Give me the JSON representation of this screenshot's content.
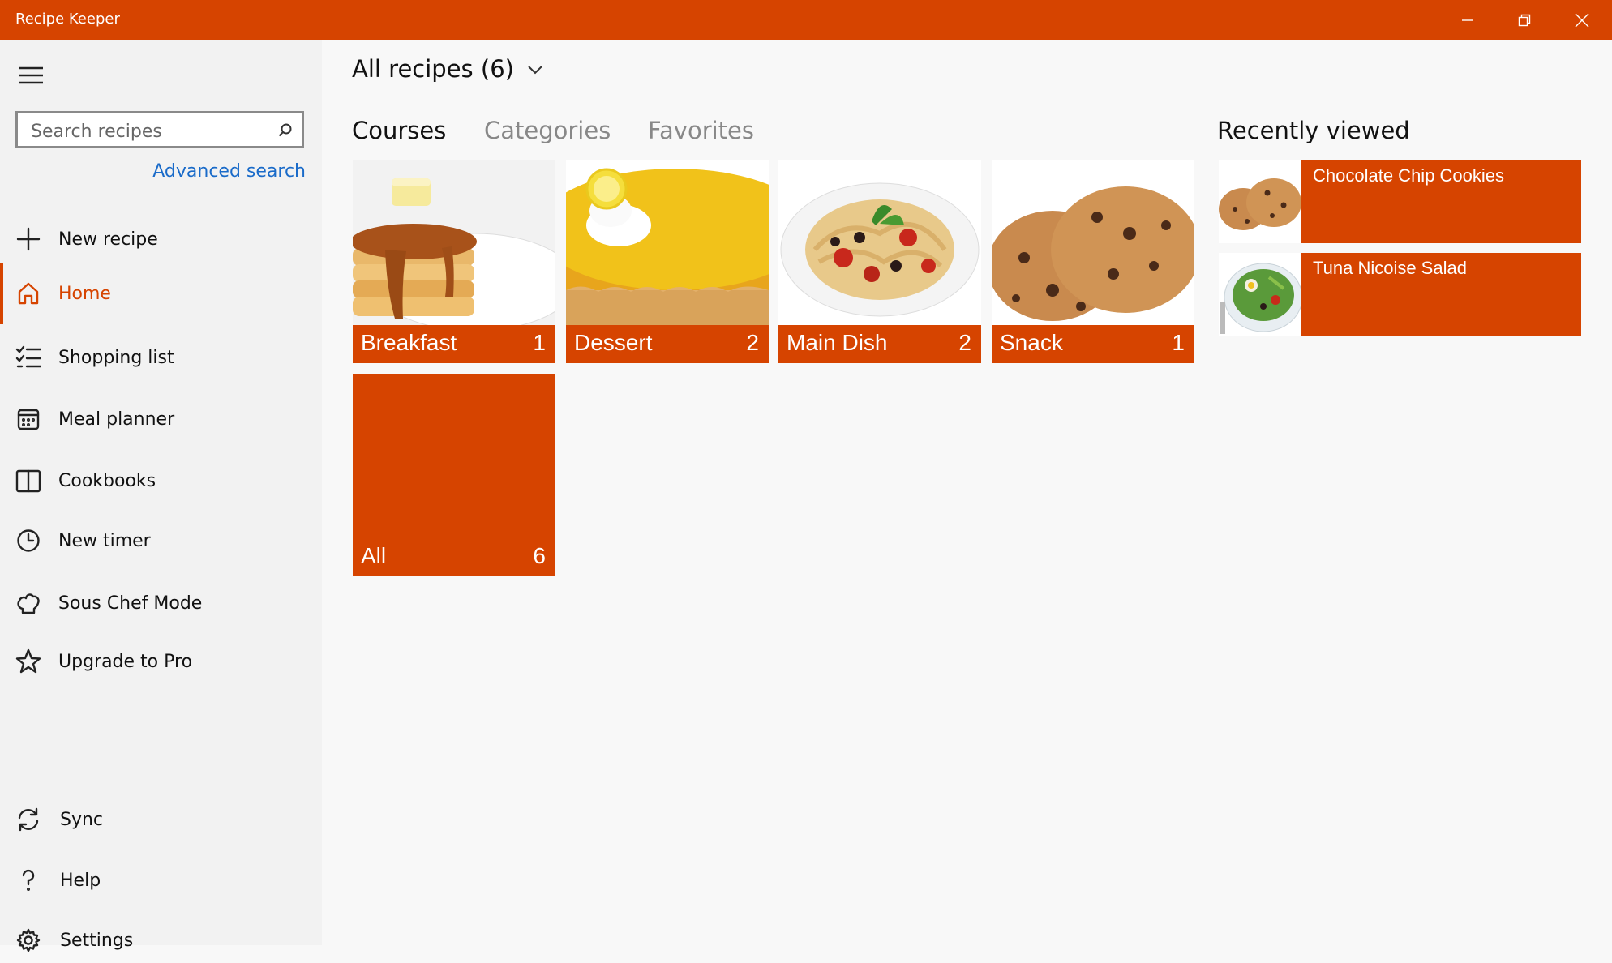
{
  "app": {
    "title": "Recipe Keeper",
    "accent": "#d64400"
  },
  "sidebar": {
    "search_placeholder": "Search recipes",
    "advanced_search": "Advanced search",
    "new_recipe": "New recipe",
    "items": [
      {
        "label": "Home",
        "icon": "home-icon",
        "active": true
      },
      {
        "label": "Shopping list",
        "icon": "checklist-icon"
      },
      {
        "label": "Meal planner",
        "icon": "calendar-icon"
      },
      {
        "label": "Cookbooks",
        "icon": "book-icon"
      },
      {
        "label": "New timer",
        "icon": "clock-icon"
      },
      {
        "label": "Sous Chef Mode",
        "icon": "chef-hat-icon"
      },
      {
        "label": "Upgrade to Pro",
        "icon": "star-icon"
      }
    ],
    "footer": [
      {
        "label": "Sync",
        "icon": "sync-icon"
      },
      {
        "label": "Help",
        "icon": "help-icon"
      },
      {
        "label": "Settings",
        "icon": "gear-icon"
      }
    ]
  },
  "main": {
    "header": "All recipes (6)",
    "tabs": [
      {
        "label": "Courses",
        "selected": true
      },
      {
        "label": "Categories"
      },
      {
        "label": "Favorites"
      }
    ],
    "courses": [
      {
        "name": "Breakfast",
        "count": "1",
        "image": "pancakes"
      },
      {
        "name": "Dessert",
        "count": "2",
        "image": "lemon-tart"
      },
      {
        "name": "Main Dish",
        "count": "2",
        "image": "spaghetti"
      },
      {
        "name": "Snack",
        "count": "1",
        "image": "cookies"
      },
      {
        "name": "All",
        "count": "6"
      }
    ]
  },
  "recently_viewed": {
    "title": "Recently viewed",
    "items": [
      {
        "name": "Chocolate Chip Cookies",
        "image": "cookies"
      },
      {
        "name": "Tuna Nicoise Salad",
        "image": "salad"
      }
    ]
  }
}
